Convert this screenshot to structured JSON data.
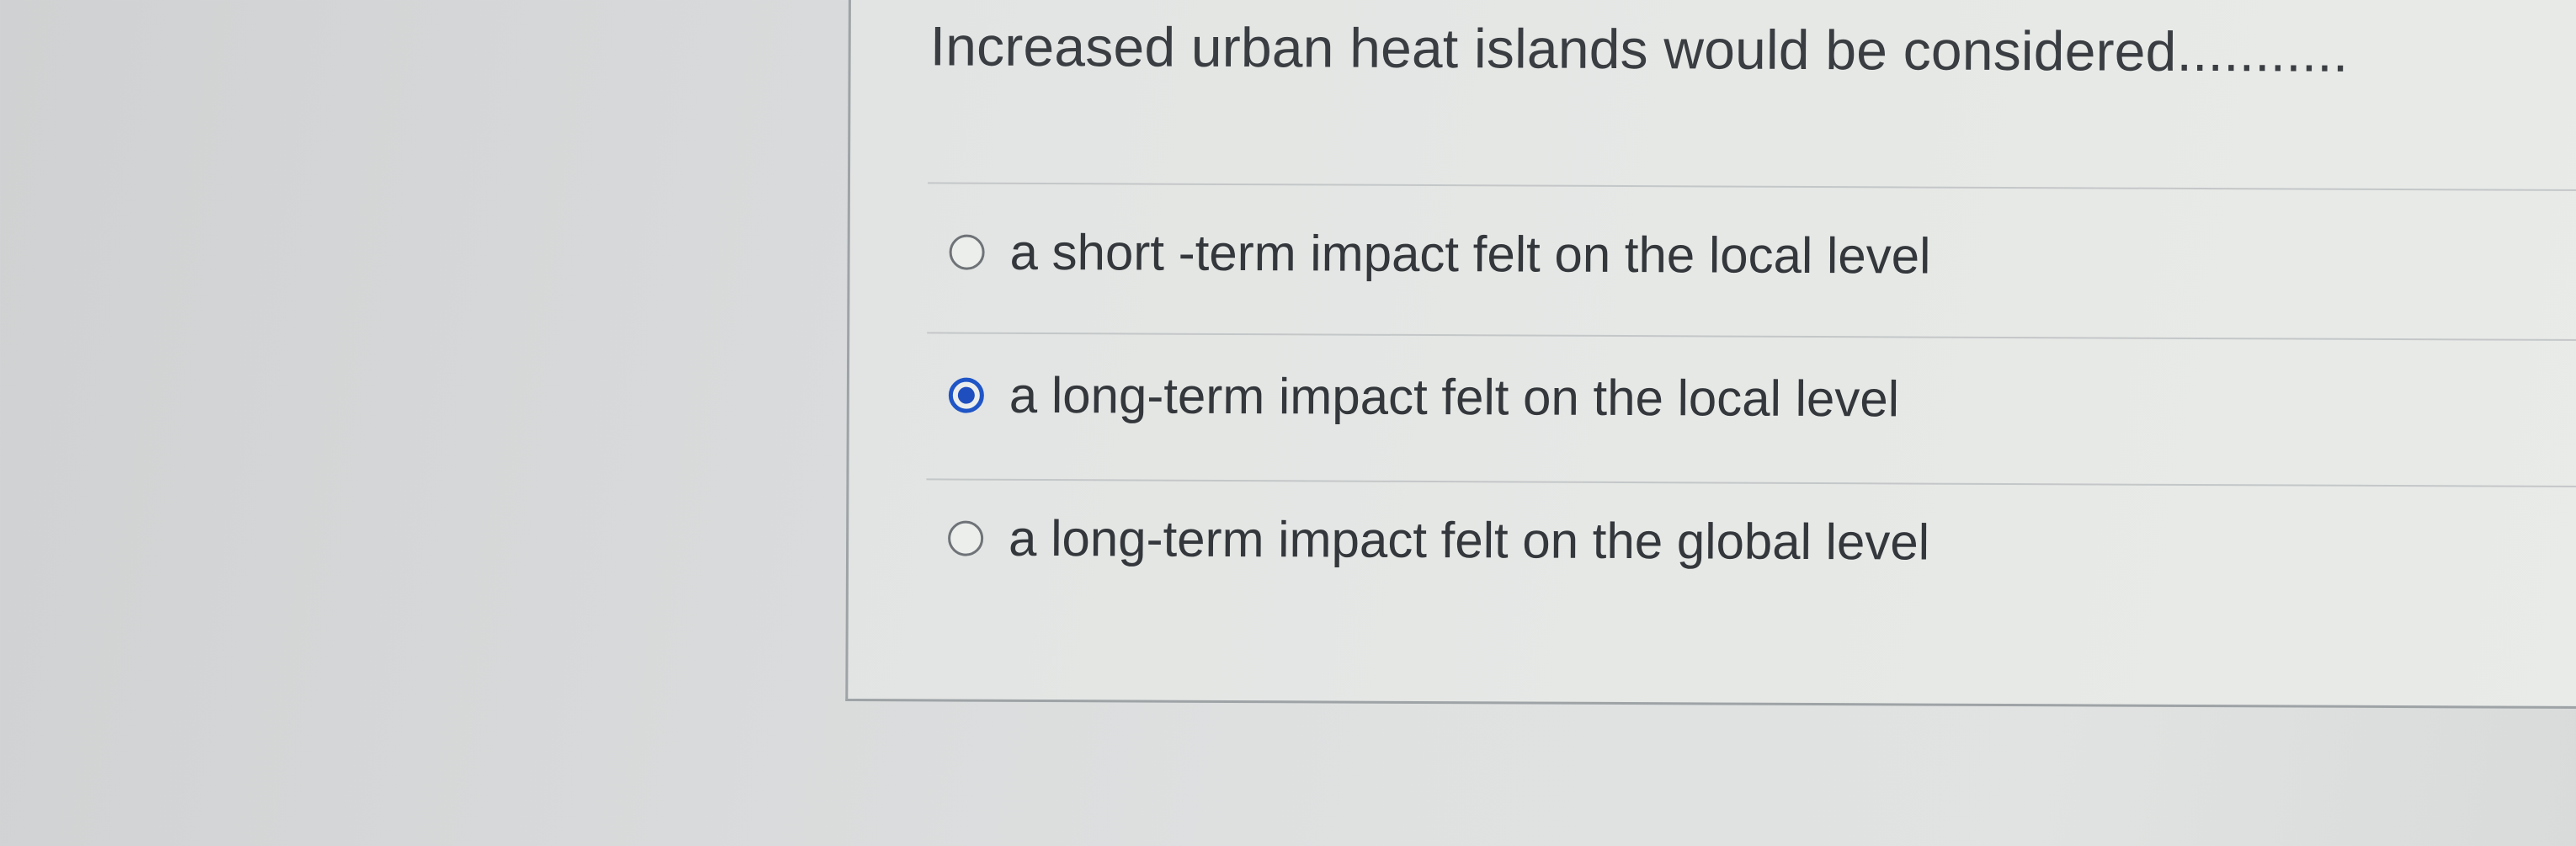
{
  "question": {
    "text": "Increased urban heat islands would be considered..........."
  },
  "options": [
    {
      "label": "a short -term impact felt on the local level",
      "selected": false
    },
    {
      "label": "a long-term impact felt on the local level",
      "selected": true
    },
    {
      "label": "a long-term impact felt on the global level",
      "selected": false
    }
  ],
  "colors": {
    "selected_radio": "#1f55c6",
    "text": "#34373b",
    "background": "#e3e5e4"
  }
}
